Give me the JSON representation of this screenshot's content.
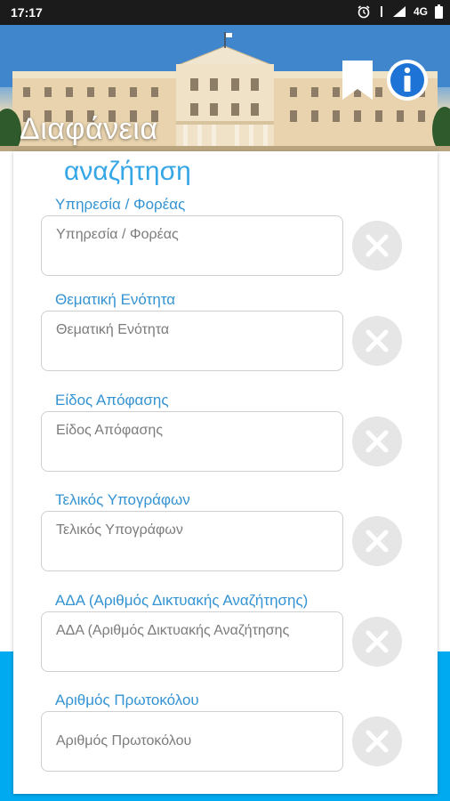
{
  "status_bar": {
    "time": "17:17",
    "network": "4G"
  },
  "header": {
    "title": "Διαφάνεια"
  },
  "icons": {
    "bookmark": "bookmark-icon",
    "info": "info-icon",
    "clear": "close-icon"
  },
  "colors": {
    "accent": "#35a6e6",
    "label": "#3493d3",
    "band": "#00aaf0",
    "clear_bg": "#e6e6e6"
  },
  "search": {
    "title": "αναζήτηση",
    "fields": [
      {
        "label": "Υπηρεσία / Φορέας",
        "placeholder": "Υπηρεσία / Φορέας"
      },
      {
        "label": "Θεματική Ενότητα",
        "placeholder": "Θεματική Ενότητα"
      },
      {
        "label": "Είδος Απόφασης",
        "placeholder": "Είδος Απόφασης"
      },
      {
        "label": "Τελικός Υπογράφων",
        "placeholder": "Τελικός Υπογράφων"
      },
      {
        "label": "ΑΔΑ (Αριθμός Δικτυακής Αναζήτησης)",
        "placeholder": "ΑΔΑ (Αριθμός Δικτυακής Αναζήτησης"
      },
      {
        "label": "Αριθμός Πρωτοκόλου",
        "placeholder": "Αριθμός Πρωτοκόλου"
      }
    ]
  }
}
